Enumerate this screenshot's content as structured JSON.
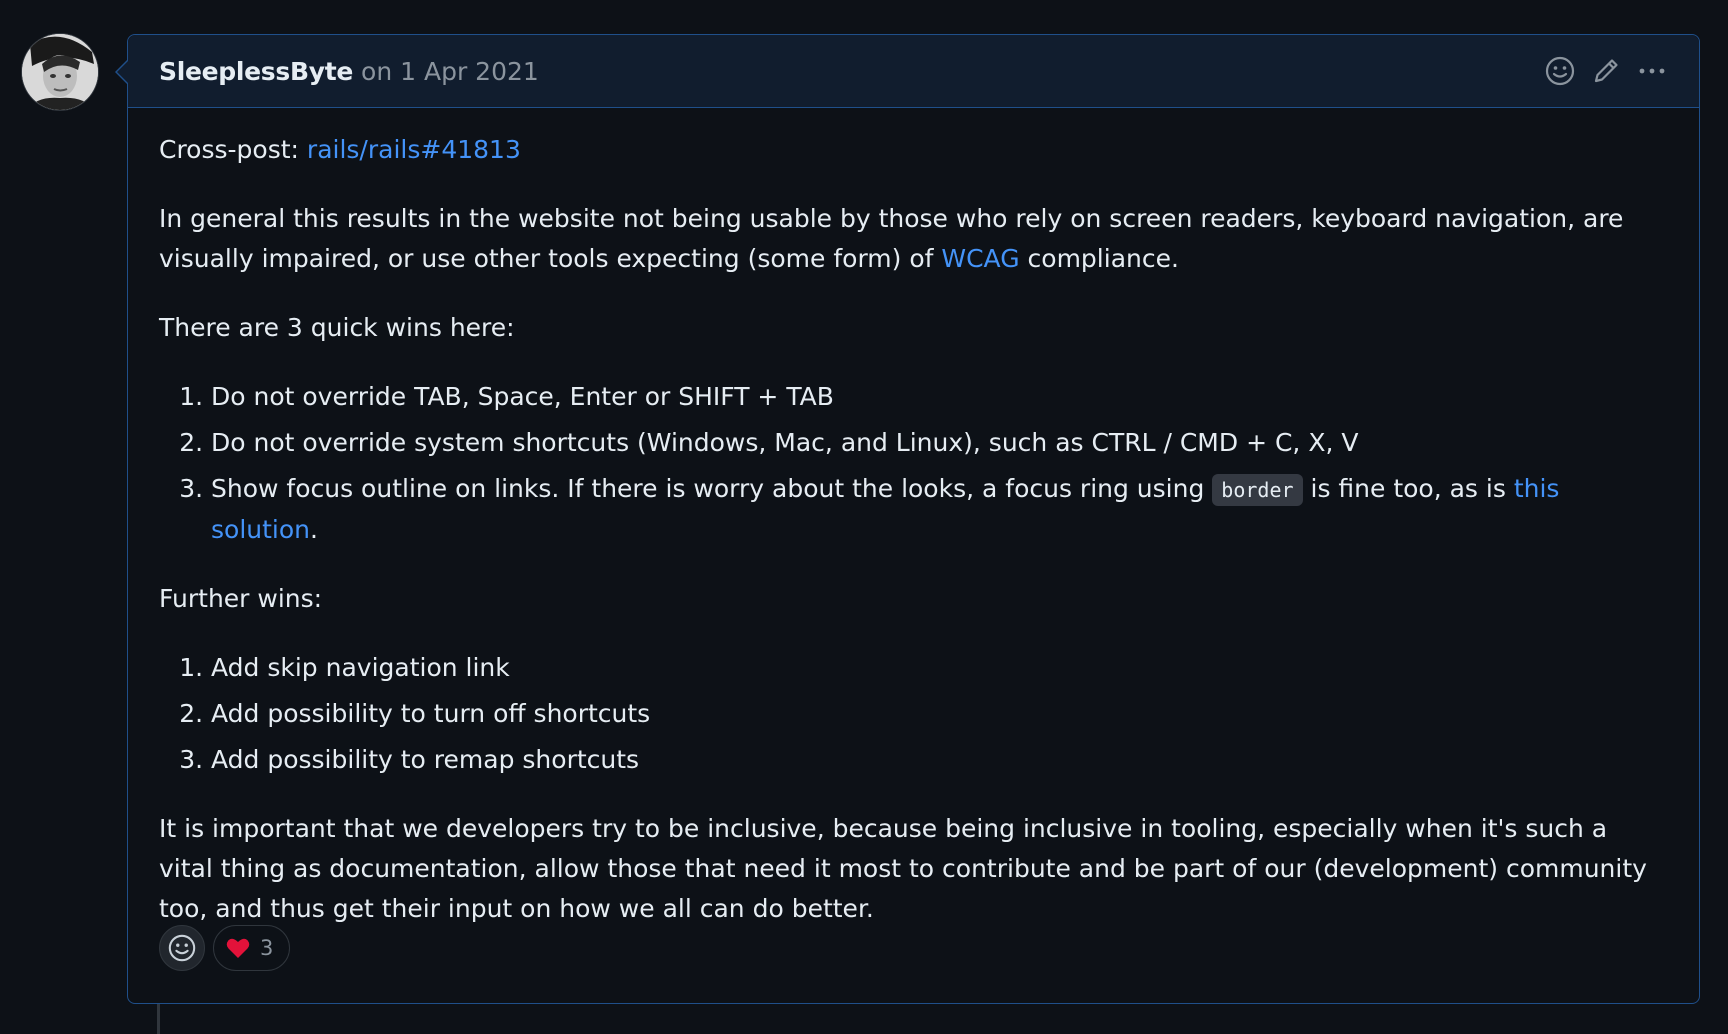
{
  "comment": {
    "author": "SleeplessByte",
    "date": "on 1 Apr 2021",
    "crosspost_prefix": "Cross-post: ",
    "crosspost_link": "rails/rails#41813",
    "para1_a": "In general this results in the website not being usable by those who rely on screen readers, keyboard navigation, are visually impaired, or use other tools expecting (some form) of ",
    "para1_link": "WCAG",
    "para1_b": " compliance.",
    "quick_wins_heading": "There are 3 quick wins here:",
    "quick_wins": [
      "Do not override TAB, Space, Enter or SHIFT + TAB",
      "Do not override system shortcuts (Windows, Mac, and Linux), such as CTRL / CMD + C, X, V"
    ],
    "quick_win3_a": "Show focus outline on links. If there is worry about the looks, a focus ring using ",
    "quick_win3_code": "border",
    "quick_win3_b": " is fine too, as is ",
    "quick_win3_link": "this solution",
    "quick_win3_c": ".",
    "further_heading": "Further wins:",
    "further_wins": [
      "Add skip navigation link",
      "Add possibility to turn off shortcuts",
      "Add possibility to remap shortcuts"
    ],
    "closing": "It is important that we developers try to be inclusive, because being inclusive in tooling, especially when it's such a vital thing as documentation, allow those that need it most to contribute and be part of our (development) community too, and thus get their input on how we all can do better."
  },
  "header_icons": [
    "smiley-icon",
    "pencil-icon",
    "kebab-menu-icon"
  ],
  "reactions": {
    "add_icon": "smiley-icon",
    "heart": {
      "emoji": "❤️",
      "count": "3"
    }
  },
  "colors": {
    "background": "#0d1117",
    "header_bg": "#111d2e",
    "border_accent": "#1f4f8a",
    "link": "#4493f8",
    "muted": "#8b949e",
    "text": "#e6edf3"
  }
}
